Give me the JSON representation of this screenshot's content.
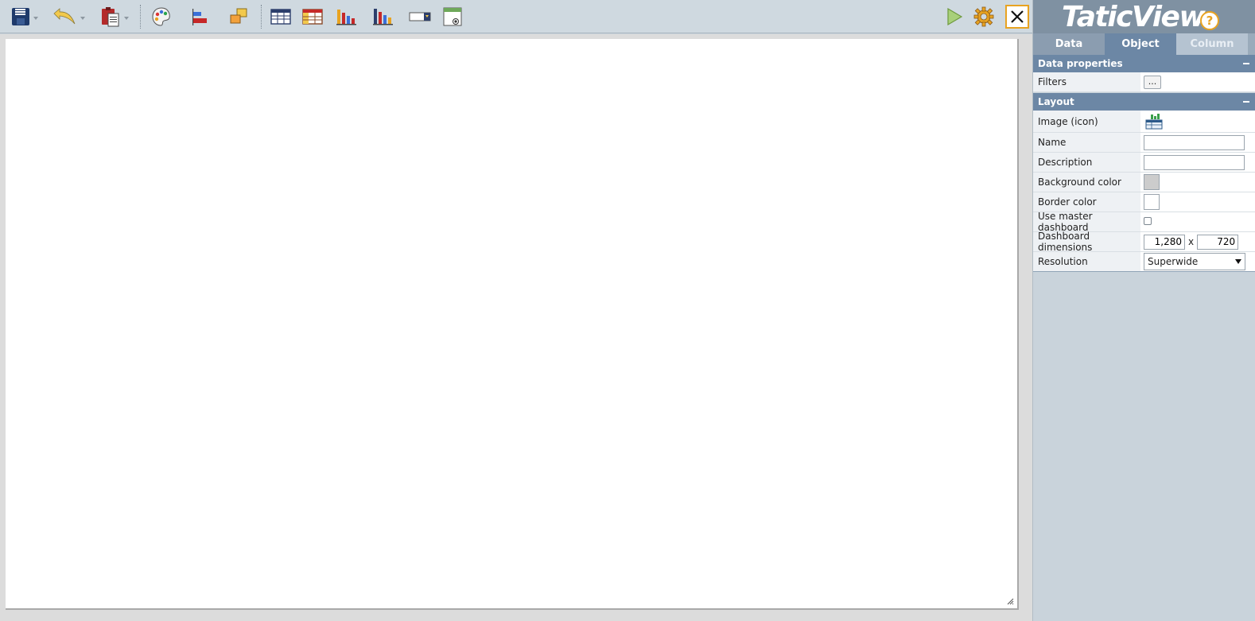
{
  "toolbar": {
    "buttons": [
      {
        "name": "save",
        "icon": "floppy-disk-icon"
      },
      {
        "name": "undo",
        "icon": "undo-arrow-icon"
      },
      {
        "name": "paste",
        "icon": "clipboard-icon"
      },
      {
        "name": "theme",
        "icon": "palette-icon"
      },
      {
        "name": "align",
        "icon": "align-icon"
      },
      {
        "name": "arrange",
        "icon": "arrange-layers-icon"
      },
      {
        "name": "table",
        "icon": "table-icon"
      },
      {
        "name": "pivot-table",
        "icon": "pivot-table-icon"
      },
      {
        "name": "bar-chart",
        "icon": "bar-chart-icon"
      },
      {
        "name": "combo-chart",
        "icon": "combo-chart-icon"
      },
      {
        "name": "dropdown-filter",
        "icon": "dropdown-filter-icon"
      },
      {
        "name": "radio-filter",
        "icon": "radio-filter-icon"
      },
      {
        "name": "preview",
        "icon": "play-icon"
      },
      {
        "name": "settings",
        "icon": "gear-icon"
      },
      {
        "name": "close",
        "icon": "close-icon"
      }
    ]
  },
  "brand": {
    "logo": "TaticView",
    "help_label": "?"
  },
  "colors": {
    "accent": "#6c87a5",
    "brand_bg": "#7f91a2",
    "help": "#e8a321",
    "play": "#93c15a",
    "gear": "#e8a321",
    "close_border": "#e8a321"
  },
  "tabs": [
    {
      "label": "Data",
      "state": "normal"
    },
    {
      "label": "Object",
      "state": "active"
    },
    {
      "label": "Column",
      "state": "disabled"
    }
  ],
  "sections": {
    "data_properties": {
      "title": "Data properties",
      "rows": {
        "filters": {
          "label": "Filters",
          "button": "..."
        }
      }
    },
    "layout": {
      "title": "Layout",
      "rows": {
        "image": {
          "label": "Image (icon)",
          "icon": "dashboard-image-icon"
        },
        "name": {
          "label": "Name",
          "value": ""
        },
        "description": {
          "label": "Description",
          "value": ""
        },
        "background_color": {
          "label": "Background color",
          "value": "#cccccc"
        },
        "border_color": {
          "label": "Border color",
          "value": "#ffffff"
        },
        "use_master": {
          "label": "Use master dashboard",
          "checked": false
        },
        "dimensions": {
          "label": "Dashboard dimensions",
          "width": "1,280",
          "sep": "x",
          "height": "720"
        },
        "resolution": {
          "label": "Resolution",
          "selected": "Superwide"
        }
      }
    }
  }
}
